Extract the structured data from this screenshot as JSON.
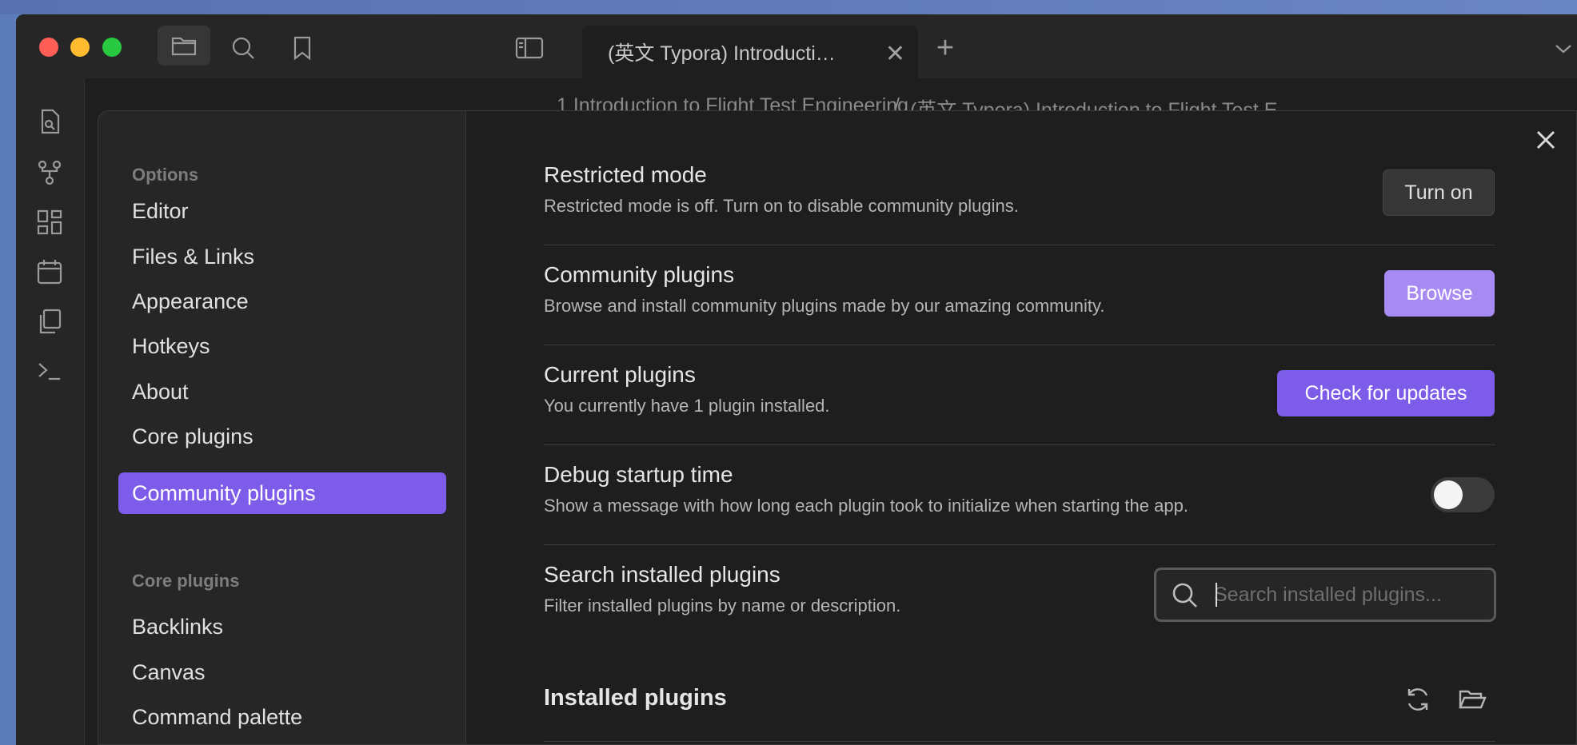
{
  "titlebar": {
    "tab_title": "(英文 Typora) Introducti…",
    "tab_close": "✕",
    "new_tab": "+"
  },
  "breadcrumb": {
    "parent": "1 Introduction to Flight Test Engineering",
    "separator": "/",
    "current": "(英文 Typora) Introduction to Flight Test E"
  },
  "sidebar": {
    "options_label": "Options",
    "options_items": [
      "Editor",
      "Files & Links",
      "Appearance",
      "Hotkeys",
      "About",
      "Core plugins",
      "Community plugins"
    ],
    "active_item": "Community plugins",
    "core_plugins_label": "Core plugins",
    "core_items": [
      "Backlinks",
      "Canvas",
      "Command palette"
    ]
  },
  "settings": {
    "restricted": {
      "title": "Restricted mode",
      "desc": "Restricted mode is off. Turn on to disable community plugins.",
      "button": "Turn on"
    },
    "community": {
      "title": "Community plugins",
      "desc": "Browse and install community plugins made by our amazing community.",
      "button": "Browse"
    },
    "current": {
      "title": "Current plugins",
      "desc": "You currently have 1 plugin installed.",
      "button": "Check for updates"
    },
    "debug": {
      "title": "Debug startup time",
      "desc": "Show a message with how long each plugin took to initialize when starting the app.",
      "toggle_on": false
    },
    "search": {
      "title": "Search installed plugins",
      "desc": "Filter installed plugins by name or description.",
      "placeholder": "Search installed plugins..."
    },
    "installed": {
      "title": "Installed plugins"
    }
  },
  "colors": {
    "accent": "#7c5ce8",
    "browse_button": "#a88bf2",
    "background": "#1e1e1e",
    "sidebar": "#262626"
  }
}
